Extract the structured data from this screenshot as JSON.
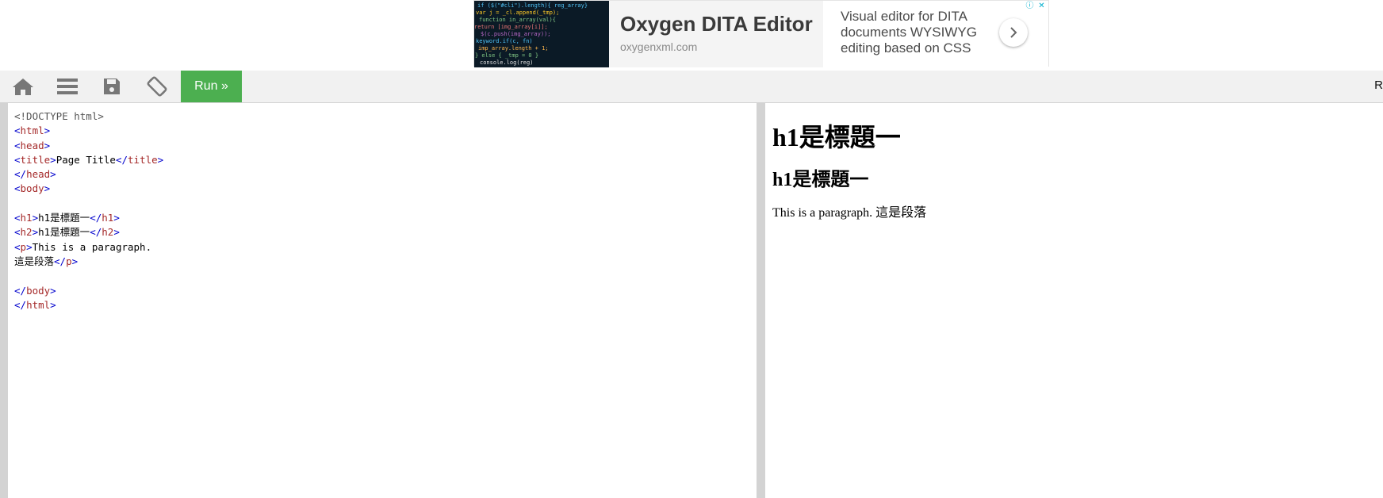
{
  "ad": {
    "title": "Oxygen DITA Editor",
    "domain": "oxygenxml.com",
    "description": "Visual editor for DITA documents WYSIWYG editing based on CSS",
    "next_icon": "chevron-right-icon",
    "badge_info": "ⓘ",
    "badge_close": "✕"
  },
  "toolbar": {
    "home_icon": "home-icon",
    "menu_icon": "menu-icon",
    "save_icon": "save-icon",
    "rotate_icon": "rotate-icon",
    "run_label": "Run »",
    "right_text": "R",
    "run_color": "#4caf50"
  },
  "code": {
    "lines": [
      {
        "parts": [
          {
            "t": "doc",
            "v": "<!DOCTYPE html>"
          }
        ]
      },
      {
        "parts": [
          {
            "t": "br",
            "v": "<"
          },
          {
            "t": "tag",
            "v": "html"
          },
          {
            "t": "br",
            "v": ">"
          }
        ]
      },
      {
        "parts": [
          {
            "t": "br",
            "v": "<"
          },
          {
            "t": "tag",
            "v": "head"
          },
          {
            "t": "br",
            "v": ">"
          }
        ]
      },
      {
        "parts": [
          {
            "t": "br",
            "v": "<"
          },
          {
            "t": "tag",
            "v": "title"
          },
          {
            "t": "br",
            "v": ">"
          },
          {
            "t": "txt",
            "v": "Page Title"
          },
          {
            "t": "br",
            "v": "</"
          },
          {
            "t": "tag",
            "v": "title"
          },
          {
            "t": "br",
            "v": ">"
          }
        ]
      },
      {
        "parts": [
          {
            "t": "br",
            "v": "</"
          },
          {
            "t": "tag",
            "v": "head"
          },
          {
            "t": "br",
            "v": ">"
          }
        ]
      },
      {
        "parts": [
          {
            "t": "br",
            "v": "<"
          },
          {
            "t": "tag",
            "v": "body"
          },
          {
            "t": "br",
            "v": ">"
          }
        ]
      },
      {
        "parts": []
      },
      {
        "parts": [
          {
            "t": "br",
            "v": "<"
          },
          {
            "t": "tag",
            "v": "h1"
          },
          {
            "t": "br",
            "v": ">"
          },
          {
            "t": "txt",
            "v": "h1是標題一"
          },
          {
            "t": "br",
            "v": "</"
          },
          {
            "t": "tag",
            "v": "h1"
          },
          {
            "t": "br",
            "v": ">"
          }
        ]
      },
      {
        "parts": [
          {
            "t": "br",
            "v": "<"
          },
          {
            "t": "tag",
            "v": "h2"
          },
          {
            "t": "br",
            "v": ">"
          },
          {
            "t": "txt",
            "v": "h1是標題一"
          },
          {
            "t": "br",
            "v": "</"
          },
          {
            "t": "tag",
            "v": "h2"
          },
          {
            "t": "br",
            "v": ">"
          }
        ]
      },
      {
        "parts": [
          {
            "t": "br",
            "v": "<"
          },
          {
            "t": "tag",
            "v": "p"
          },
          {
            "t": "br",
            "v": ">"
          },
          {
            "t": "txt",
            "v": "This is a paragraph."
          }
        ]
      },
      {
        "parts": [
          {
            "t": "txt",
            "v": "這是段落"
          },
          {
            "t": "br",
            "v": "</"
          },
          {
            "t": "tag",
            "v": "p"
          },
          {
            "t": "br",
            "v": ">"
          }
        ]
      },
      {
        "parts": []
      },
      {
        "parts": [
          {
            "t": "br",
            "v": "</"
          },
          {
            "t": "tag",
            "v": "body"
          },
          {
            "t": "br",
            "v": ">"
          }
        ]
      },
      {
        "parts": [
          {
            "t": "br",
            "v": "</"
          },
          {
            "t": "tag",
            "v": "html"
          },
          {
            "t": "br",
            "v": ">"
          }
        ]
      }
    ]
  },
  "result": {
    "h1": "h1是標題一",
    "h2": "h1是標題一",
    "p": "This is a paragraph. 這是段落"
  }
}
